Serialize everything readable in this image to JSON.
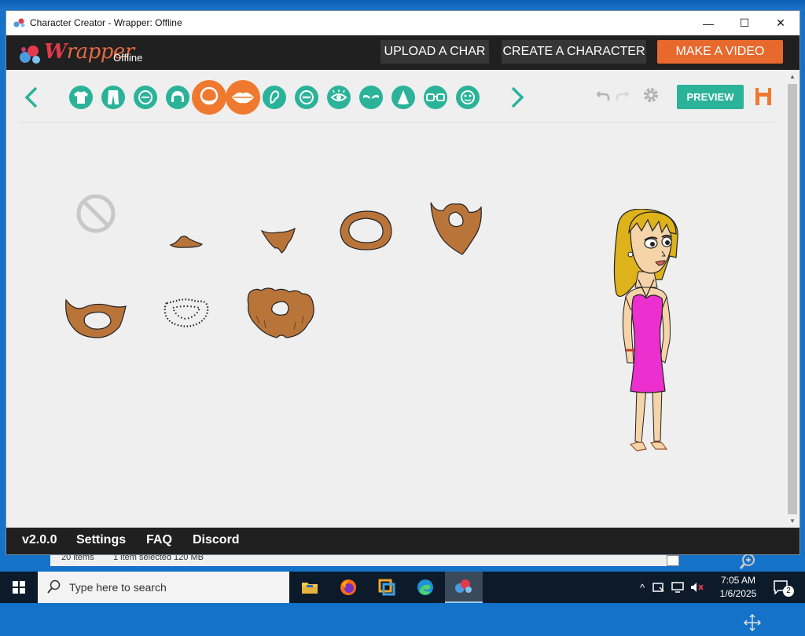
{
  "window": {
    "title": "Character Creator - Wrapper: Offline",
    "controls": {
      "minimize": "—",
      "maximize": "☐",
      "close": "✕"
    }
  },
  "header": {
    "logo_text_w": "W",
    "logo_text_rest": "rapper",
    "logo_sub": "Offline",
    "buttons": {
      "upload": "UPLOAD A CHAR",
      "create": "CREATE A CHARACTER",
      "video": "MAKE A VIDEO"
    }
  },
  "toolbar": {
    "categories": [
      {
        "icon": "shirt-icon"
      },
      {
        "icon": "pants-icon"
      },
      {
        "icon": "face-icon"
      },
      {
        "icon": "hair-icon"
      },
      {
        "icon": "beard-icon",
        "active": true
      },
      {
        "icon": "mouth-icon",
        "active": true
      },
      {
        "icon": "ear-icon"
      },
      {
        "icon": "eye-face-icon"
      },
      {
        "icon": "eye-icon"
      },
      {
        "icon": "eyebrow-icon"
      },
      {
        "icon": "nose-icon"
      },
      {
        "icon": "glasses-icon"
      },
      {
        "icon": "mask-icon"
      }
    ],
    "preview_label": "PREVIEW"
  },
  "footer": {
    "version": "v2.0.0",
    "settings": "Settings",
    "faq": "FAQ",
    "discord": "Discord"
  },
  "explorer_status": {
    "items": "20 items",
    "selected": "1 item selected  120 MB"
  },
  "taskbar": {
    "search_placeholder": "Type here to search",
    "time": "7:05 AM",
    "date": "1/6/2025",
    "notification_count": "2"
  },
  "colors": {
    "accent_teal": "#2bb39a",
    "accent_orange": "#ef7a2f",
    "header_bg": "#202020",
    "beard_brown": "#b9743a"
  }
}
